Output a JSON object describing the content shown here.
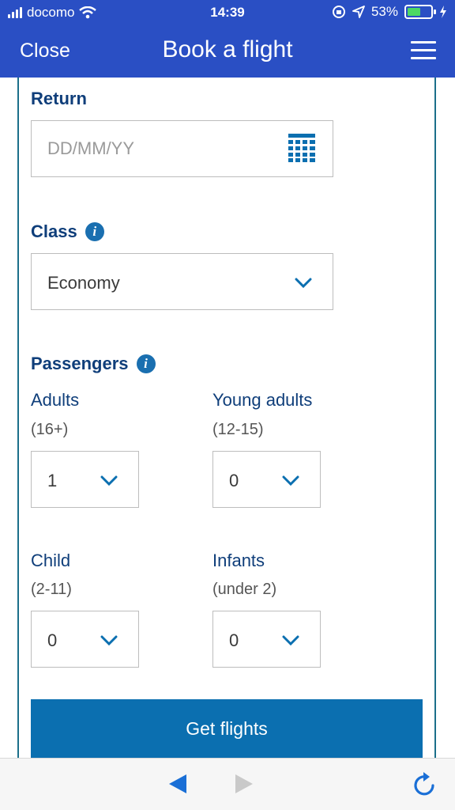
{
  "status_bar": {
    "carrier": "docomo",
    "time": "14:39",
    "battery_percent": "53%",
    "battery_level": 0.53
  },
  "header": {
    "close_label": "Close",
    "title": "Book a flight",
    "menu_icon": "hamburger-menu-icon"
  },
  "form": {
    "return": {
      "label": "Return",
      "placeholder": "DD/MM/YY",
      "icon": "calendar-icon"
    },
    "class": {
      "label": "Class",
      "info_glyph": "i",
      "value": "Economy"
    },
    "passengers": {
      "label": "Passengers",
      "info_glyph": "i",
      "adults": {
        "label": "Adults",
        "range": "(16+)",
        "value": "1"
      },
      "young_adults": {
        "label": "Young adults",
        "range": "(12-15)",
        "value": "0"
      },
      "child": {
        "label": "Child",
        "range": "(2-11)",
        "value": "0"
      },
      "infants": {
        "label": "Infants",
        "range": "(under 2)",
        "value": "0"
      }
    },
    "submit_label": "Get flights"
  },
  "colors": {
    "header_bg": "#2a4fc4",
    "label_color": "#0f3e7a",
    "accent": "#0b6fb0",
    "battery_fill": "#4cd964"
  }
}
